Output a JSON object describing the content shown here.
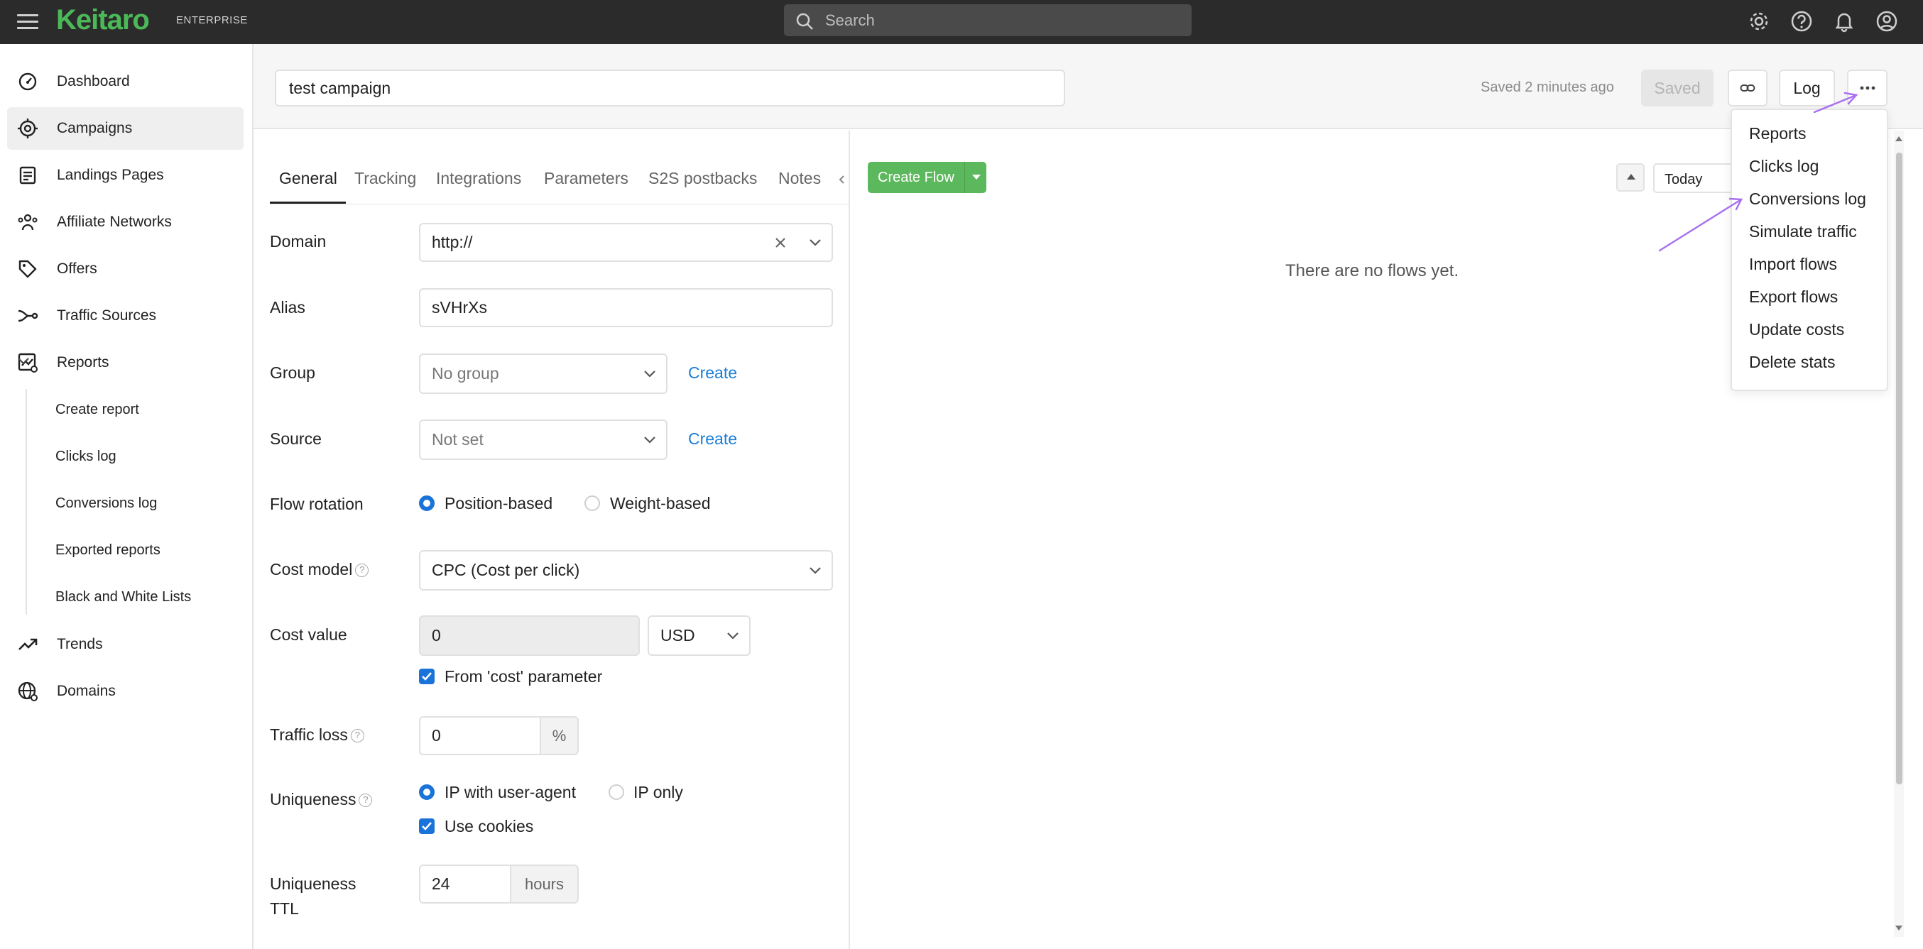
{
  "app": {
    "logo": "Keitaro",
    "edition": "ENTERPRISE",
    "search_placeholder": "Search"
  },
  "colors": {
    "brand_green": "#4cb959",
    "topbar": "#2b2b2b",
    "accent_blue": "#1a73d9",
    "link_blue": "#1a7ed6",
    "create_flow_green": "#5cb85c",
    "annotation_purple": "#a970f0"
  },
  "sidebar": {
    "items": [
      {
        "label": "Dashboard",
        "icon": "gauge-icon"
      },
      {
        "label": "Campaigns",
        "icon": "target-icon"
      },
      {
        "label": "Landings Pages",
        "icon": "page-icon"
      },
      {
        "label": "Affiliate Networks",
        "icon": "people-icon"
      },
      {
        "label": "Offers",
        "icon": "tag-icon"
      },
      {
        "label": "Traffic Sources",
        "icon": "route-icon"
      },
      {
        "label": "Reports",
        "icon": "report-chart-icon"
      },
      {
        "label": "Trends",
        "icon": "trend-icon"
      },
      {
        "label": "Domains",
        "icon": "globe-icon"
      }
    ],
    "report_subitems": [
      "Create report",
      "Clicks log",
      "Conversions log",
      "Exported reports",
      "Black and White Lists"
    ]
  },
  "header": {
    "campaign_name": "test campaign",
    "saved_status": "Saved 2 minutes ago",
    "saved_button": "Saved",
    "log_button": "Log"
  },
  "tabs": [
    "General",
    "Tracking",
    "Integrations",
    "Parameters",
    "S2S postbacks",
    "Notes"
  ],
  "form": {
    "domain_label": "Domain",
    "domain_value": "http://",
    "alias_label": "Alias",
    "alias_value": "sVHrXs",
    "group_label": "Group",
    "group_value": "No group",
    "group_create": "Create",
    "source_label": "Source",
    "source_value": "Not set",
    "source_create": "Create",
    "flow_rotation_label": "Flow rotation",
    "flow_rotation_options": [
      "Position-based",
      "Weight-based"
    ],
    "cost_model_label": "Cost model",
    "cost_model_value": "CPC (Cost per click)",
    "cost_value_label": "Cost value",
    "cost_value": "0",
    "currency": "USD",
    "from_cost_param": "From 'cost' parameter",
    "traffic_loss_label": "Traffic loss",
    "traffic_loss_value": "0",
    "traffic_loss_unit": "%",
    "uniqueness_label": "Uniqueness",
    "uniqueness_options": [
      "IP with user-agent",
      "IP only"
    ],
    "use_cookies": "Use cookies",
    "uniqueness_ttl_label_1": "Uniqueness",
    "uniqueness_ttl_label_2": "TTL",
    "uniqueness_ttl_value": "24",
    "uniqueness_ttl_unit": "hours"
  },
  "flows": {
    "create_flow": "Create Flow",
    "period": "Today",
    "empty_message": "There are no flows yet."
  },
  "menu": {
    "items": [
      "Reports",
      "Clicks log",
      "Conversions log",
      "Simulate traffic",
      "Import flows",
      "Export flows",
      "Update costs",
      "Delete stats"
    ]
  }
}
